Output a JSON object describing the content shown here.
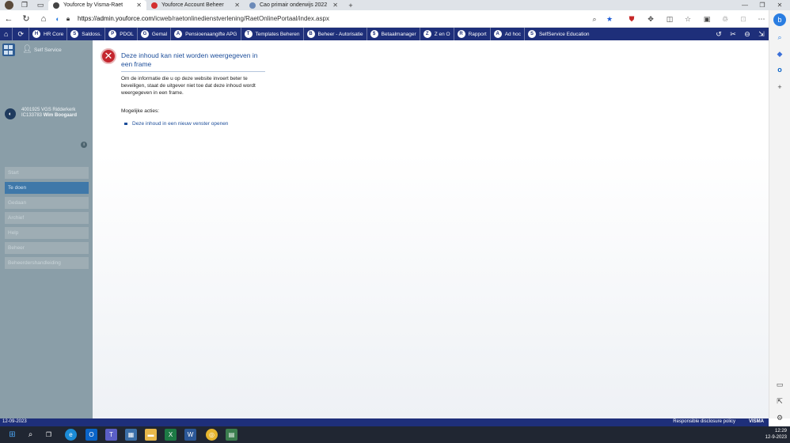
{
  "browser": {
    "tabs": [
      {
        "title": "Youforce by Visma-Raet",
        "active": true,
        "color": "#444444"
      },
      {
        "title": "Youforce Account Beheer",
        "active": false,
        "color": "#d32f2f"
      },
      {
        "title": "Cao primair onderwijs 2022",
        "active": false,
        "color": "#6c8ab8"
      }
    ],
    "new_tab": "+",
    "url_host": "https://admin.youforce.com",
    "url_path": "/icweb/raetonlinedienstverlening/RaetOnlinePortaal/index.aspx"
  },
  "appnav": {
    "items": [
      {
        "label": "HR Core",
        "icon": "H"
      },
      {
        "label": "Saldoss.",
        "icon": "S"
      },
      {
        "label": "PDOL",
        "icon": "P"
      },
      {
        "label": "Gemal",
        "icon": "G"
      },
      {
        "label": "Pensioenaangifte APG",
        "icon": "A"
      },
      {
        "label": "Templates Beheren",
        "icon": "T"
      },
      {
        "label": "Beheer - Autorisatie",
        "icon": "B"
      },
      {
        "label": "Betaalmanager",
        "icon": "$"
      },
      {
        "label": "Z en O",
        "icon": "Z"
      },
      {
        "label": "Rapport",
        "icon": "R"
      },
      {
        "label": "Ad hoc",
        "icon": "A"
      },
      {
        "label": "SelfService Education",
        "icon": "S"
      }
    ]
  },
  "sidebar": {
    "self_service": "Self Service",
    "org_line1": "4001925 VGS Ridderkerk",
    "org_code": "IC133783",
    "org_user": "Wim Boogaard",
    "items": [
      {
        "label": "Start",
        "active": false
      },
      {
        "label": "Te doen",
        "active": true
      },
      {
        "label": "Gedaan",
        "active": false
      },
      {
        "label": "Archief",
        "active": false
      },
      {
        "label": "Help",
        "active": false
      },
      {
        "label": "Beheer",
        "active": false
      },
      {
        "label": "Beheerdershandleiding",
        "active": false
      }
    ]
  },
  "error": {
    "title": "Deze inhoud kan niet worden weergegeven in een frame",
    "description": "Om de informatie die u op deze website invoert beter te beveiligen, staat de uitgever niet toe dat deze inhoud wordt weergegeven in een frame.",
    "actions_label": "Mogelijke acties:",
    "link": "Deze inhoud in een nieuw venster openen"
  },
  "footer": {
    "date": "12-09-2023",
    "disclosure": "Responsible disclosure policy",
    "brand": "VISMA"
  },
  "taskbar": {
    "time": "12:29",
    "date": "12-9-2023"
  }
}
